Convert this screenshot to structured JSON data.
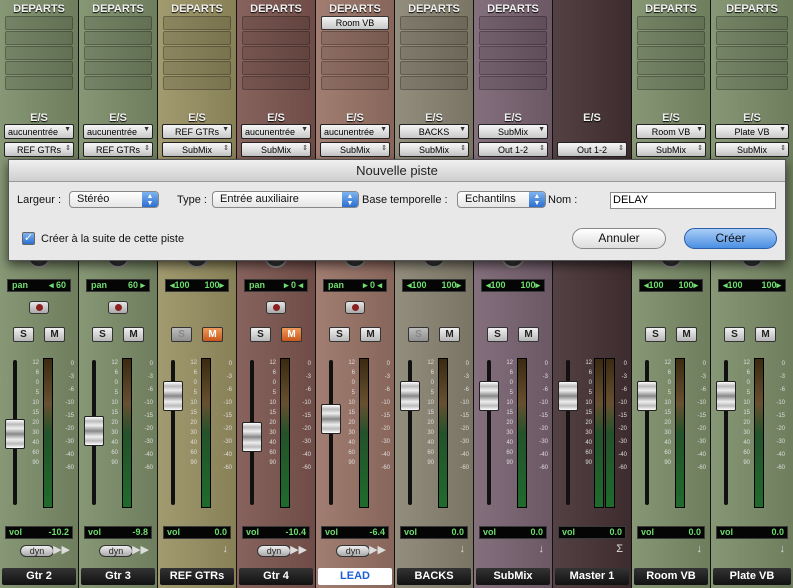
{
  "colors": {
    "green": "#7d8f6a",
    "gold": "#9a9263",
    "red": "#7e5650",
    "salmon": "#9a7366",
    "purple": "#7a6472",
    "tan": "#8a8472",
    "dark_red": "#453134",
    "meter_green": "#6fdc6f",
    "dialog_bg": "#e8e8e8",
    "accent_blue": "#4b8fe2"
  },
  "tracks": [
    {
      "name": "Gtr 2",
      "header": "DEPARTS",
      "io_label": "E/S",
      "input": "aucunentrée",
      "output": "REF GTRs",
      "send": "",
      "pan_label": "pan",
      "pan_value": "◂ 60",
      "show_rec": true,
      "solo": "S",
      "mute": "M",
      "mute_active": false,
      "solo_dim": false,
      "vol_label": "vol",
      "volume": "-10.2",
      "fader_level": 0.54,
      "dyn": "dyn",
      "selected": false,
      "icon": "double-arrow-icon",
      "color": "#7d8f6a",
      "io_center": false
    },
    {
      "name": "Gtr 3",
      "header": "DEPARTS",
      "io_label": "E/S",
      "input": "aucunentrée",
      "output": "REF GTRs",
      "send": "",
      "pan_label": "pan",
      "pan_value": "60 ▸",
      "show_rec": true,
      "solo": "S",
      "mute": "M",
      "mute_active": false,
      "solo_dim": false,
      "vol_label": "vol",
      "volume": "-9.8",
      "fader_level": 0.56,
      "dyn": "dyn",
      "selected": false,
      "icon": "double-arrow-icon",
      "color": "#7d8f6a",
      "io_center": false
    },
    {
      "name": "REF GTRs",
      "header": "DEPARTS",
      "io_label": "E/S",
      "input": "REF GTRs",
      "output": "SubMix",
      "send": "",
      "pan_label": "◂100",
      "pan_value": "100▸",
      "show_rec": false,
      "solo": "S",
      "mute": "M",
      "mute_active": true,
      "solo_dim": true,
      "vol_label": "vol",
      "volume": "0.0",
      "fader_level": 0.8,
      "dyn": "",
      "selected": false,
      "icon": "down-arrow-icon",
      "color": "#9a9263",
      "io_center": true
    },
    {
      "name": "Gtr 4",
      "header": "DEPARTS",
      "io_label": "E/S",
      "input": "aucunentrée",
      "output": "SubMix",
      "send": "",
      "pan_label": "pan",
      "pan_value": "▸ 0 ◂",
      "show_rec": true,
      "solo": "S",
      "mute": "M",
      "mute_active": true,
      "solo_dim": false,
      "vol_label": "vol",
      "volume": "-10.4",
      "fader_level": 0.52,
      "dyn": "dyn",
      "selected": false,
      "icon": "double-arrow-icon",
      "color": "#7e5650",
      "io_center": false
    },
    {
      "name": "LEAD",
      "header": "DEPARTS",
      "io_label": "E/S",
      "input": "aucunentrée",
      "output": "SubMix",
      "send": "Room VB",
      "pan_label": "pan",
      "pan_value": "▸ 0 ◂",
      "show_rec": true,
      "solo": "S",
      "mute": "M",
      "mute_active": false,
      "solo_dim": false,
      "vol_label": "vol",
      "volume": "-6.4",
      "fader_level": 0.64,
      "dyn": "dyn",
      "selected": true,
      "icon": "double-arrow-icon",
      "color": "#9a7366",
      "io_center": false
    },
    {
      "name": "BACKS",
      "header": "DEPARTS",
      "io_label": "E/S",
      "input": "BACKS",
      "output": "SubMix",
      "send": "",
      "pan_label": "◂100",
      "pan_value": "100▸",
      "show_rec": false,
      "solo": "S",
      "mute": "M",
      "mute_active": false,
      "solo_dim": true,
      "vol_label": "vol",
      "volume": "0.0",
      "fader_level": 0.8,
      "dyn": "",
      "selected": false,
      "icon": "down-arrow-icon",
      "color": "#8a8472",
      "io_center": true
    },
    {
      "name": "SubMix",
      "header": "DEPARTS",
      "io_label": "E/S",
      "input": "SubMix",
      "output": "Out 1-2",
      "send": "",
      "pan_label": "◂100",
      "pan_value": "100▸",
      "show_rec": false,
      "solo": "S",
      "mute": "M",
      "mute_active": false,
      "solo_dim": false,
      "vol_label": "vol",
      "volume": "0.0",
      "fader_level": 0.8,
      "dyn": "",
      "selected": false,
      "icon": "down-arrow-icon",
      "color": "#7a6472",
      "io_center": true
    },
    {
      "name": "Master 1",
      "header": "",
      "io_label": "E/S",
      "input": "",
      "output": "Out 1-2",
      "send": "",
      "pan_label": "",
      "pan_value": "",
      "show_rec": false,
      "solo": "",
      "mute": "",
      "mute_active": false,
      "solo_dim": false,
      "vol_label": "vol",
      "volume": "0.0",
      "fader_level": 0.8,
      "dyn": "",
      "selected": false,
      "icon": "sigma-icon",
      "color": "#453134",
      "io_center": true
    },
    {
      "name": "Room VB",
      "header": "DEPARTS",
      "io_label": "E/S",
      "input": "Room VB",
      "output": "SubMix",
      "send": "",
      "pan_label": "◂100",
      "pan_value": "100▸",
      "show_rec": false,
      "solo": "S",
      "mute": "M",
      "mute_active": false,
      "solo_dim": false,
      "vol_label": "vol",
      "volume": "0.0",
      "fader_level": 0.8,
      "dyn": "",
      "selected": false,
      "icon": "down-arrow-icon",
      "color": "#7d8f6a",
      "io_center": true
    },
    {
      "name": "Plate VB",
      "header": "DEPARTS",
      "io_label": "E/S",
      "input": "Plate VB",
      "output": "SubMix",
      "send": "",
      "pan_label": "◂100",
      "pan_value": "100▸",
      "show_rec": false,
      "solo": "S",
      "mute": "M",
      "mute_active": false,
      "solo_dim": false,
      "vol_label": "vol",
      "volume": "0.0",
      "fader_level": 0.8,
      "dyn": "",
      "selected": false,
      "icon": "down-arrow-icon",
      "color": "#7d8f6a",
      "io_center": true
    }
  ],
  "fader_scale": [
    "12",
    "6",
    "0",
    "5",
    "10",
    "15",
    "20",
    "30",
    "40",
    "60",
    "90"
  ],
  "meter_scale": [
    "0",
    "-3",
    "-6",
    "-10",
    "-15",
    "-20",
    "-30",
    "-40",
    "-60"
  ],
  "dialog": {
    "title": "Nouvelle piste",
    "width_label": "Largeur :",
    "width_value": "Stéréo",
    "type_label": "Type :",
    "type_value": "Entrée auxiliaire",
    "timebase_label": "Base temporelle :",
    "timebase_value": "Echantilns",
    "name_label": "Nom :",
    "name_value": "DELAY",
    "checkbox_label": "Créer à la suite de cette piste",
    "checkbox_checked": true,
    "cancel_label": "Annuler",
    "create_label": "Créer"
  }
}
